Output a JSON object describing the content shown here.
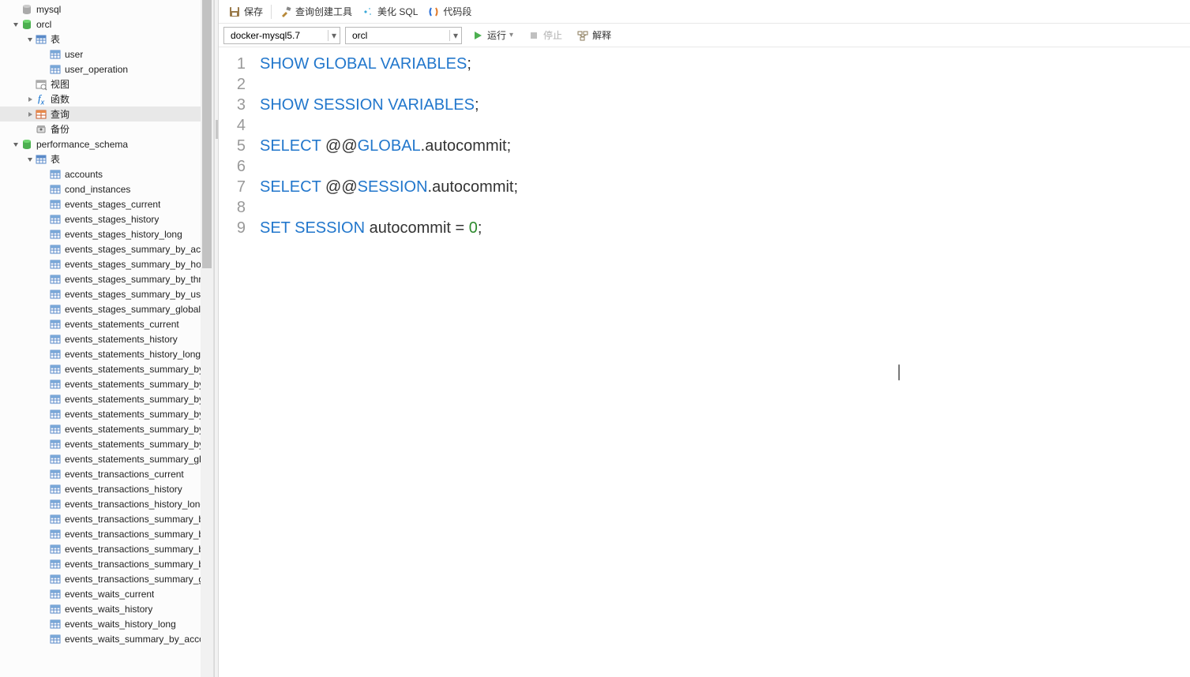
{
  "sidebar": {
    "tree": [
      {
        "depth": 0,
        "arrow": "none",
        "icon": "db-gray",
        "label": "mysql"
      },
      {
        "depth": 0,
        "arrow": "open",
        "icon": "db-green",
        "label": "orcl"
      },
      {
        "depth": 1,
        "arrow": "open",
        "icon": "tables",
        "label": "表"
      },
      {
        "depth": 2,
        "arrow": "none",
        "icon": "table",
        "label": "user"
      },
      {
        "depth": 2,
        "arrow": "none",
        "icon": "table",
        "label": "user_operation"
      },
      {
        "depth": 1,
        "arrow": "none",
        "icon": "view",
        "label": "视图"
      },
      {
        "depth": 1,
        "arrow": "closed",
        "icon": "fx",
        "label": "函数"
      },
      {
        "depth": 1,
        "arrow": "closed",
        "icon": "query",
        "label": "查询",
        "highlighted": true
      },
      {
        "depth": 1,
        "arrow": "none",
        "icon": "backup",
        "label": "备份"
      },
      {
        "depth": 0,
        "arrow": "open",
        "icon": "db-green",
        "label": "performance_schema"
      },
      {
        "depth": 1,
        "arrow": "open",
        "icon": "tables",
        "label": "表"
      },
      {
        "depth": 2,
        "arrow": "none",
        "icon": "table",
        "label": "accounts"
      },
      {
        "depth": 2,
        "arrow": "none",
        "icon": "table",
        "label": "cond_instances"
      },
      {
        "depth": 2,
        "arrow": "none",
        "icon": "table",
        "label": "events_stages_current"
      },
      {
        "depth": 2,
        "arrow": "none",
        "icon": "table",
        "label": "events_stages_history"
      },
      {
        "depth": 2,
        "arrow": "none",
        "icon": "table",
        "label": "events_stages_history_long"
      },
      {
        "depth": 2,
        "arrow": "none",
        "icon": "table",
        "label": "events_stages_summary_by_account"
      },
      {
        "depth": 2,
        "arrow": "none",
        "icon": "table",
        "label": "events_stages_summary_by_host_by"
      },
      {
        "depth": 2,
        "arrow": "none",
        "icon": "table",
        "label": "events_stages_summary_by_thread"
      },
      {
        "depth": 2,
        "arrow": "none",
        "icon": "table",
        "label": "events_stages_summary_by_user_by"
      },
      {
        "depth": 2,
        "arrow": "none",
        "icon": "table",
        "label": "events_stages_summary_global_by"
      },
      {
        "depth": 2,
        "arrow": "none",
        "icon": "table",
        "label": "events_statements_current"
      },
      {
        "depth": 2,
        "arrow": "none",
        "icon": "table",
        "label": "events_statements_history"
      },
      {
        "depth": 2,
        "arrow": "none",
        "icon": "table",
        "label": "events_statements_history_long"
      },
      {
        "depth": 2,
        "arrow": "none",
        "icon": "table",
        "label": "events_statements_summary_by_ac"
      },
      {
        "depth": 2,
        "arrow": "none",
        "icon": "table",
        "label": "events_statements_summary_by_di"
      },
      {
        "depth": 2,
        "arrow": "none",
        "icon": "table",
        "label": "events_statements_summary_by_ho"
      },
      {
        "depth": 2,
        "arrow": "none",
        "icon": "table",
        "label": "events_statements_summary_by_pr"
      },
      {
        "depth": 2,
        "arrow": "none",
        "icon": "table",
        "label": "events_statements_summary_by_th"
      },
      {
        "depth": 2,
        "arrow": "none",
        "icon": "table",
        "label": "events_statements_summary_by_us"
      },
      {
        "depth": 2,
        "arrow": "none",
        "icon": "table",
        "label": "events_statements_summary_globa"
      },
      {
        "depth": 2,
        "arrow": "none",
        "icon": "table",
        "label": "events_transactions_current"
      },
      {
        "depth": 2,
        "arrow": "none",
        "icon": "table",
        "label": "events_transactions_history"
      },
      {
        "depth": 2,
        "arrow": "none",
        "icon": "table",
        "label": "events_transactions_history_long"
      },
      {
        "depth": 2,
        "arrow": "none",
        "icon": "table",
        "label": "events_transactions_summary_by_a"
      },
      {
        "depth": 2,
        "arrow": "none",
        "icon": "table",
        "label": "events_transactions_summary_by_h"
      },
      {
        "depth": 2,
        "arrow": "none",
        "icon": "table",
        "label": "events_transactions_summary_by_t"
      },
      {
        "depth": 2,
        "arrow": "none",
        "icon": "table",
        "label": "events_transactions_summary_by_u"
      },
      {
        "depth": 2,
        "arrow": "none",
        "icon": "table",
        "label": "events_transactions_summary_glob"
      },
      {
        "depth": 2,
        "arrow": "none",
        "icon": "table",
        "label": "events_waits_current"
      },
      {
        "depth": 2,
        "arrow": "none",
        "icon": "table",
        "label": "events_waits_history"
      },
      {
        "depth": 2,
        "arrow": "none",
        "icon": "table",
        "label": "events_waits_history_long"
      },
      {
        "depth": 2,
        "arrow": "none",
        "icon": "table",
        "label": "events_waits_summary_by_account"
      }
    ]
  },
  "toolbar1": {
    "save": "保存",
    "builder": "查询创建工具",
    "beautify": "美化 SQL",
    "snippet": "代码段"
  },
  "toolbar2": {
    "connection": "docker-mysql5.7",
    "database": "orcl",
    "run": "运行",
    "stop": "停止",
    "explain": "解释"
  },
  "editor": {
    "lines": [
      {
        "n": 1,
        "tokens": [
          {
            "t": "SHOW",
            "c": "kw"
          },
          {
            "t": " "
          },
          {
            "t": "GLOBAL",
            "c": "kw"
          },
          {
            "t": " "
          },
          {
            "t": "VARIABLES",
            "c": "kw"
          },
          {
            "t": ";"
          }
        ]
      },
      {
        "n": 2,
        "tokens": []
      },
      {
        "n": 3,
        "tokens": [
          {
            "t": "SHOW",
            "c": "kw"
          },
          {
            "t": " "
          },
          {
            "t": "SESSION",
            "c": "kw"
          },
          {
            "t": " "
          },
          {
            "t": "VARIABLES",
            "c": "kw"
          },
          {
            "t": ";"
          }
        ]
      },
      {
        "n": 4,
        "tokens": []
      },
      {
        "n": 5,
        "tokens": [
          {
            "t": "SELECT",
            "c": "kw"
          },
          {
            "t": " @@"
          },
          {
            "t": "GLOBAL",
            "c": "kw"
          },
          {
            "t": ".autocommit;"
          }
        ]
      },
      {
        "n": 6,
        "tokens": []
      },
      {
        "n": 7,
        "tokens": [
          {
            "t": "SELECT",
            "c": "kw"
          },
          {
            "t": " @@"
          },
          {
            "t": "SESSION",
            "c": "kw"
          },
          {
            "t": ".autocommit;"
          }
        ]
      },
      {
        "n": 8,
        "tokens": []
      },
      {
        "n": 9,
        "tokens": [
          {
            "t": "SET",
            "c": "kw"
          },
          {
            "t": " "
          },
          {
            "t": "SESSION",
            "c": "kw"
          },
          {
            "t": " autocommit = "
          },
          {
            "t": "0",
            "c": "num"
          },
          {
            "t": ";"
          }
        ]
      }
    ]
  }
}
